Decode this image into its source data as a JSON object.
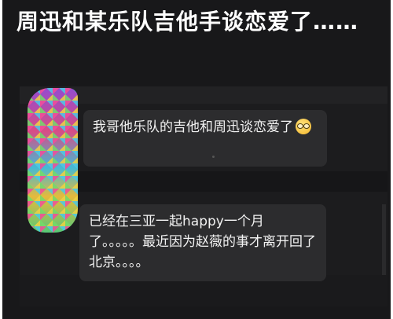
{
  "headline": "周迅和某乐队吉他手谈恋爱了……",
  "messages": [
    {
      "text": "我哥他乐队的吉他和周迅谈恋爱了",
      "emoji": "nerd-face-icon"
    },
    {
      "text": "已经在三亚一起happy一个月了。。。。。最近因为赵薇的事才离开回了北京。。。。"
    }
  ],
  "colors": {
    "background": "#18181a",
    "bubble": "#2c2c2e",
    "text": "#f2f2f2"
  }
}
